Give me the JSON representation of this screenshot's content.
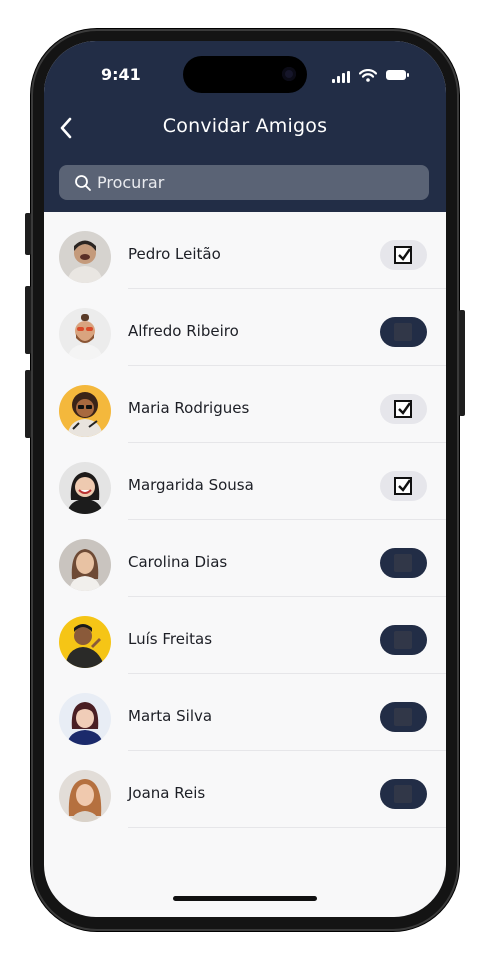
{
  "status_bar": {
    "time": "9:41"
  },
  "header": {
    "title": "Convidar Amigos",
    "back_icon": "chevron-left-icon"
  },
  "search": {
    "placeholder": "Procurar",
    "value": "",
    "icon": "search-icon"
  },
  "friends": [
    {
      "name": "Pedro Leitão",
      "selected": true,
      "avatar_bg": "#d6d3cf"
    },
    {
      "name": "Alfredo Ribeiro",
      "selected": false,
      "avatar_bg": "#ececec"
    },
    {
      "name": "Maria Rodrigues",
      "selected": true,
      "avatar_bg": "#f4b83c"
    },
    {
      "name": "Margarida Sousa",
      "selected": true,
      "avatar_bg": "#e4e4e4"
    },
    {
      "name": "Carolina Dias",
      "selected": false,
      "avatar_bg": "#c9c4bf"
    },
    {
      "name": "Luís Freitas",
      "selected": false,
      "avatar_bg": "#f5c516"
    },
    {
      "name": "Marta Silva",
      "selected": false,
      "avatar_bg": "#e8edf5"
    },
    {
      "name": "Joana Reis",
      "selected": false,
      "avatar_bg": "#e2ddd8"
    }
  ],
  "colors": {
    "header_bg": "#222d46",
    "search_bg": "#5a6375",
    "toggle_on_bg": "#e6e6eb",
    "toggle_off_bg": "#222d46",
    "list_bg": "#f8f8f9"
  }
}
